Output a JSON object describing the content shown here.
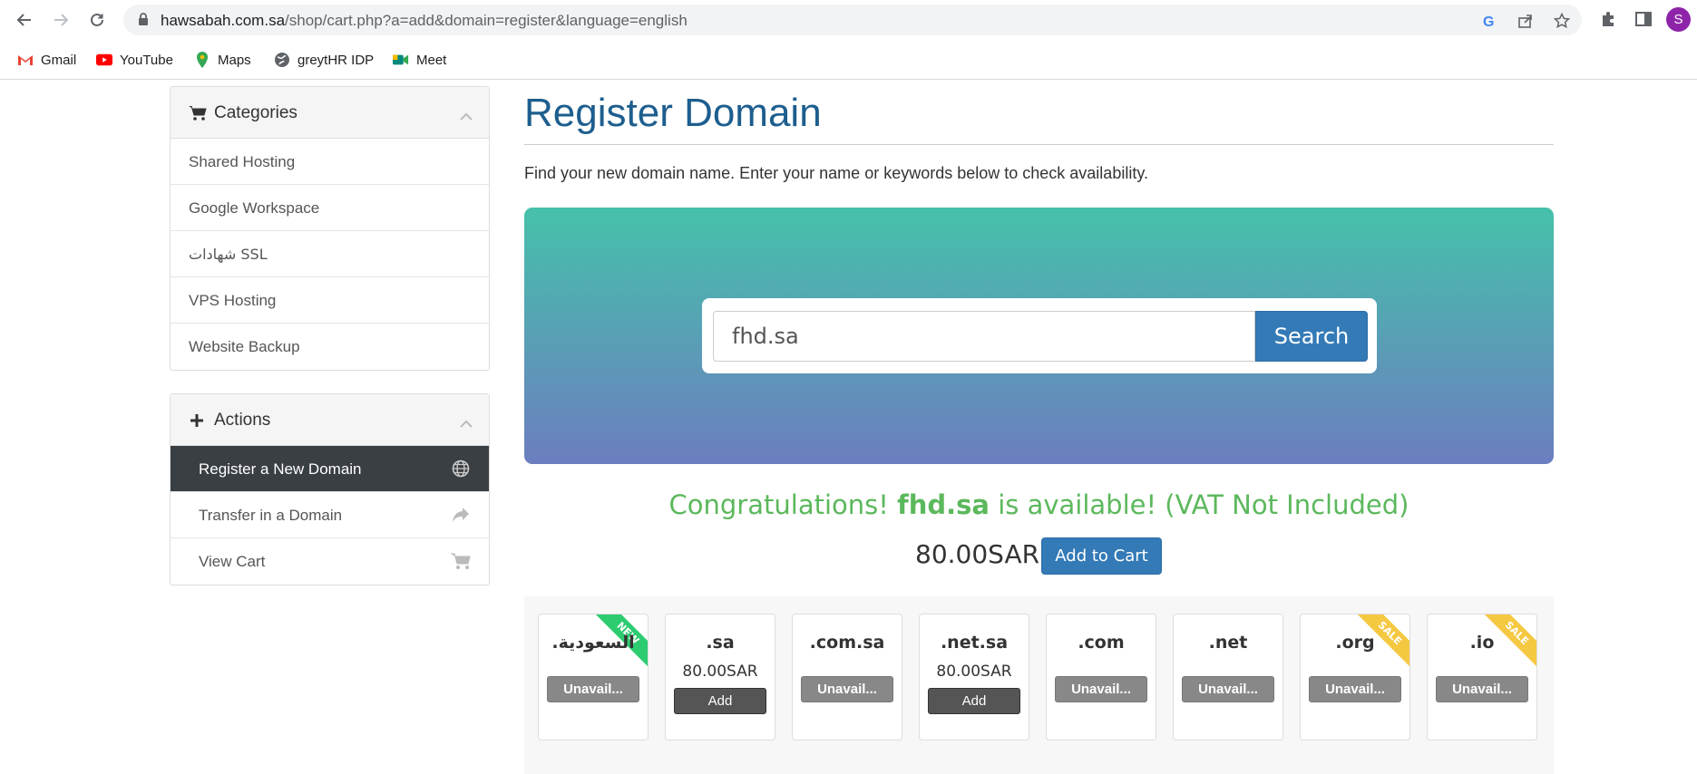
{
  "browser": {
    "url_host": "hawsabah.com.sa",
    "url_path": "/shop/cart.php?a=add&domain=register&language=english",
    "profile_initial": "S",
    "bookmarks": [
      {
        "label": "Gmail"
      },
      {
        "label": "YouTube"
      },
      {
        "label": "Maps"
      },
      {
        "label": "greytHR IDP"
      },
      {
        "label": "Meet"
      }
    ]
  },
  "sidebar": {
    "categories": {
      "title": "Categories",
      "items": [
        {
          "label": "Shared Hosting"
        },
        {
          "label": "Google Workspace"
        },
        {
          "label": "شهادات SSL"
        },
        {
          "label": "VPS Hosting"
        },
        {
          "label": "Website Backup"
        }
      ]
    },
    "actions": {
      "title": "Actions",
      "items": [
        {
          "label": "Register a New Domain",
          "icon": "globe-icon"
        },
        {
          "label": "Transfer in a Domain",
          "icon": "share-arrow-icon"
        },
        {
          "label": "View Cart",
          "icon": "cart-icon"
        }
      ]
    }
  },
  "main": {
    "title": "Register Domain",
    "intro": "Find your new domain name. Enter your name or keywords below to check availability.",
    "search": {
      "value": "fhd.sa",
      "button": "Search"
    },
    "result": {
      "prefix": "Congratulations!",
      "domain": "fhd.sa",
      "suffix": "is available! (VAT Not Included)",
      "price": "80.00SAR",
      "add_to_cart": "Add to Cart"
    },
    "tlds": [
      {
        "name": ".السعودية",
        "ribbon": "NEW",
        "status": "Unavail..."
      },
      {
        "name": ".sa",
        "price": "80.00SAR",
        "action": "Add"
      },
      {
        "name": ".com.sa",
        "status": "Unavail..."
      },
      {
        "name": ".net.sa",
        "price": "80.00SAR",
        "action": "Add"
      },
      {
        "name": ".com",
        "status": "Unavail..."
      },
      {
        "name": ".net",
        "status": "Unavail..."
      },
      {
        "name": ".org",
        "ribbon": "SALE",
        "status": "Unavail..."
      },
      {
        "name": ".io",
        "ribbon": "SALE",
        "status": "Unavail..."
      }
    ]
  },
  "colors": {
    "heading": "#1d5e8e",
    "primary_button": "#337ab7",
    "success": "#5cb85c",
    "hero_top": "#46c1aa",
    "hero_bottom": "#6b7ec0",
    "ribbon_new": "#2ecc71",
    "ribbon_sale": "#f5c842"
  }
}
